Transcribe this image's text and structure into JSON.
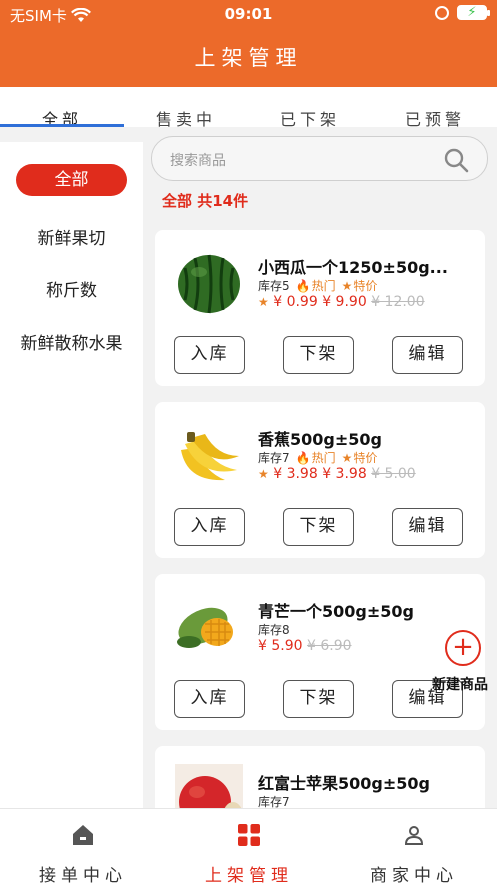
{
  "status": {
    "carrier": "无SIM卡",
    "time": "09:01"
  },
  "header": {
    "title": "上架管理"
  },
  "tabs": [
    {
      "label": "全部"
    },
    {
      "label": "售卖中"
    },
    {
      "label": "已下架"
    },
    {
      "label": "已预警"
    }
  ],
  "sidebar": {
    "categories": [
      "全部",
      "新鲜果切",
      "称斤数",
      "新鲜散称水果"
    ]
  },
  "search": {
    "placeholder": "搜索商品"
  },
  "summary": {
    "text": "全部 共14件"
  },
  "products": [
    {
      "name": "小西瓜一个1250±50g...",
      "stock": "库存5",
      "hot": "热门",
      "special": "特价",
      "price_line": "¥ 0.99 ¥ 9.90",
      "old_price": "¥ 12.00",
      "icon": "watermelon-icon"
    },
    {
      "name": "香蕉500g±50g",
      "stock": "库存7",
      "hot": "热门",
      "special": "特价",
      "price_line": "¥ 3.98 ¥ 3.98",
      "old_price": "¥ 5.00",
      "icon": "banana-icon"
    },
    {
      "name": "青芒一个500g±50g",
      "stock": "库存8",
      "price_line": "¥ 5.90",
      "old_price": "¥ 6.90",
      "icon": "mango-icon"
    },
    {
      "name": "红富士苹果500g±50g",
      "stock": "库存7",
      "icon": "apple-icon"
    }
  ],
  "buttons": {
    "stock_in": "入库",
    "delist": "下架",
    "edit": "编辑"
  },
  "fab": {
    "label": "新建商品"
  },
  "bottom_nav": [
    {
      "label": "接单中心",
      "icon": "home-icon"
    },
    {
      "label": "上架管理",
      "icon": "grid-icon"
    },
    {
      "label": "商家中心",
      "icon": "person-icon"
    }
  ],
  "colors": {
    "header": "#ec6a2a",
    "accent": "#e02c1c",
    "tag": "#e8842a",
    "tab_underline": "#2f6fd8"
  }
}
